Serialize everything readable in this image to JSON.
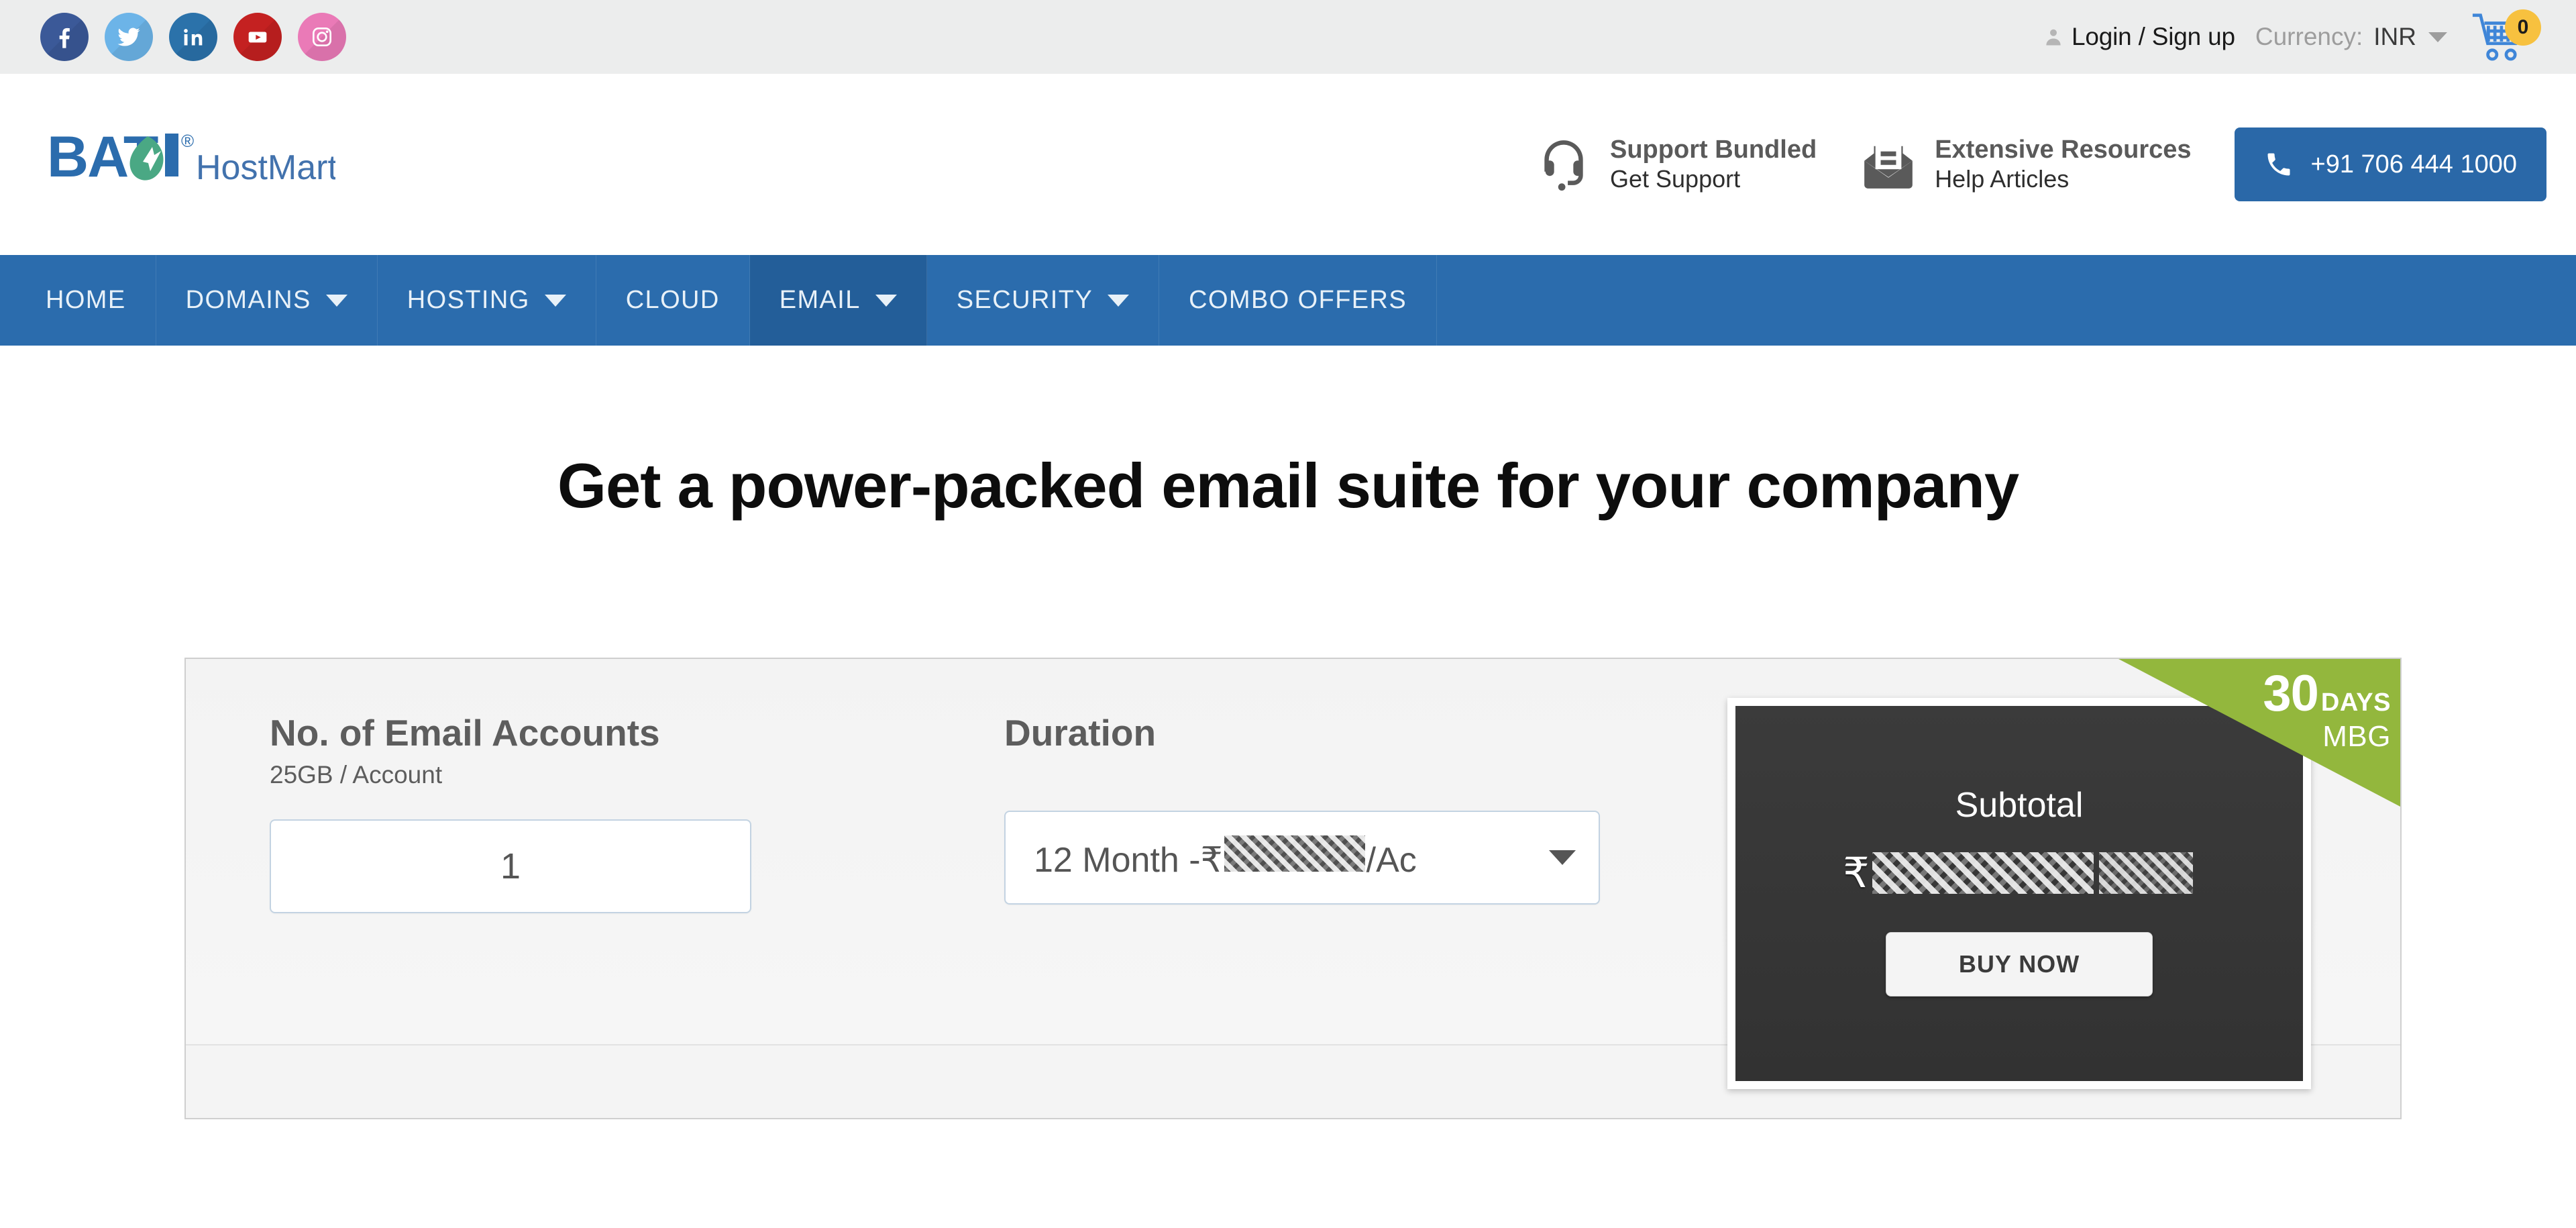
{
  "topbar": {
    "social": [
      {
        "name": "facebook",
        "color": "#3b5998"
      },
      {
        "name": "twitter",
        "color": "#6cb4e8"
      },
      {
        "name": "linkedin",
        "color": "#2b72aa"
      },
      {
        "name": "youtube",
        "color": "#c42121"
      },
      {
        "name": "instagram",
        "color": "#ea7ab7"
      }
    ],
    "login": "Login / Sign up",
    "currency_label": "Currency:",
    "currency_value": "INR",
    "cart_count": "0"
  },
  "header": {
    "brand_main": "BATOI",
    "brand_mark": "®",
    "brand_sub": "HostMart",
    "features": [
      {
        "title": "Support Bundled",
        "sub": "Get Support",
        "icon": "headset-icon"
      },
      {
        "title": "Extensive Resources",
        "sub": "Help Articles",
        "icon": "envelope-document-icon"
      }
    ],
    "phone": "+91 706 444 1000"
  },
  "nav": {
    "items": [
      {
        "label": "HOME",
        "caret": false,
        "active": false
      },
      {
        "label": "DOMAINS",
        "caret": true,
        "active": false
      },
      {
        "label": "HOSTING",
        "caret": true,
        "active": false
      },
      {
        "label": "CLOUD",
        "caret": false,
        "active": false
      },
      {
        "label": "EMAIL",
        "caret": true,
        "active": true
      },
      {
        "label": "SECURITY",
        "caret": true,
        "active": false
      },
      {
        "label": "COMBO OFFERS",
        "caret": false,
        "active": false
      }
    ]
  },
  "main": {
    "page_title": "Get a power-packed email suite for your company",
    "accounts": {
      "label": "No. of Email Accounts",
      "sublabel": "25GB / Account",
      "value": "1"
    },
    "duration": {
      "label": "Duration",
      "selected_prefix": "12 Month - ",
      "currency_symbol": "₹",
      "price_redacted": true,
      "selected_suffix": "/Ac"
    },
    "subtotal": {
      "label": "Subtotal",
      "currency_symbol": "₹",
      "amount_redacted": true,
      "buy_label": "BUY NOW"
    },
    "mbg_ribbon": {
      "number": "30",
      "unit": "DAYS",
      "abbrev": "MBG",
      "color": "#93b73d"
    }
  }
}
